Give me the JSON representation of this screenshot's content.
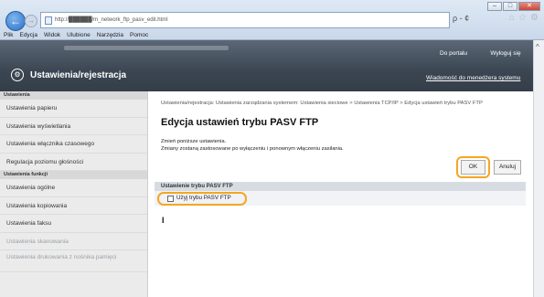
{
  "browser": {
    "url": "http://██████/m_network_ftp_pasv_edit.html",
    "menu": [
      "Plik",
      "Edycja",
      "Widok",
      "Ulubione",
      "Narzędzia",
      "Pomoc"
    ],
    "address_tools": "ρ - ¢",
    "window_buttons": [
      "–",
      "□",
      "✕"
    ],
    "back_glyph": "←",
    "forward_glyph": "→",
    "fav_glyphs": [
      "⌂",
      "☆",
      "⚙"
    ]
  },
  "header": {
    "title": "Ustawienia/rejestracja",
    "portal_link": "Do portalu",
    "logout_label": "Wyloguj się",
    "manager_link": "Wiadomość do menedżera systemu"
  },
  "sidebar": {
    "sections": [
      {
        "heading": "Ustawienia",
        "items": [
          {
            "label": "Ustawienia papieru",
            "state": "normal"
          },
          {
            "label": "Ustawienia wyświetlania",
            "state": "normal"
          },
          {
            "label": "Ustawienia włącznika czasowego",
            "state": "normal"
          },
          {
            "label": "Regulacja poziomu głośności",
            "state": "normal"
          }
        ]
      },
      {
        "heading": "Ustawienia funkcji",
        "items": [
          {
            "label": "Ustawienia ogólne",
            "state": "normal"
          },
          {
            "label": "Ustawienia kopiowania",
            "state": "normal"
          },
          {
            "label": "Ustawienia faksu",
            "state": "normal"
          },
          {
            "label": "Ustawienia skanowania",
            "state": "faded"
          },
          {
            "label": "Ustawienia drukowania z nośnika pamięci",
            "state": "faded"
          }
        ]
      }
    ]
  },
  "main": {
    "breadcrumb": "Ustawienia/rejestracja: Ustawienia zarządzania systemem: Ustawienia sieciowe > Ustawienia TCP/IP > Edycja ustawień trybu PASV FTP",
    "title": "Edycja ustawień trybu PASV FTP",
    "instruction_1": "Zmień poniższe ustawienia.",
    "instruction_2": "Zmiany zostaną zastosowane po wyłączeniu i ponownym włączeniu zasilania.",
    "ok_label": "OK",
    "cancel_label": "Anuluj",
    "section_title": "Ustawienie trybu PASV FTP",
    "checkbox_label": "Użyj trybu PASV FTP",
    "checkbox_checked": false,
    "highlight_color": "#f5a623"
  }
}
